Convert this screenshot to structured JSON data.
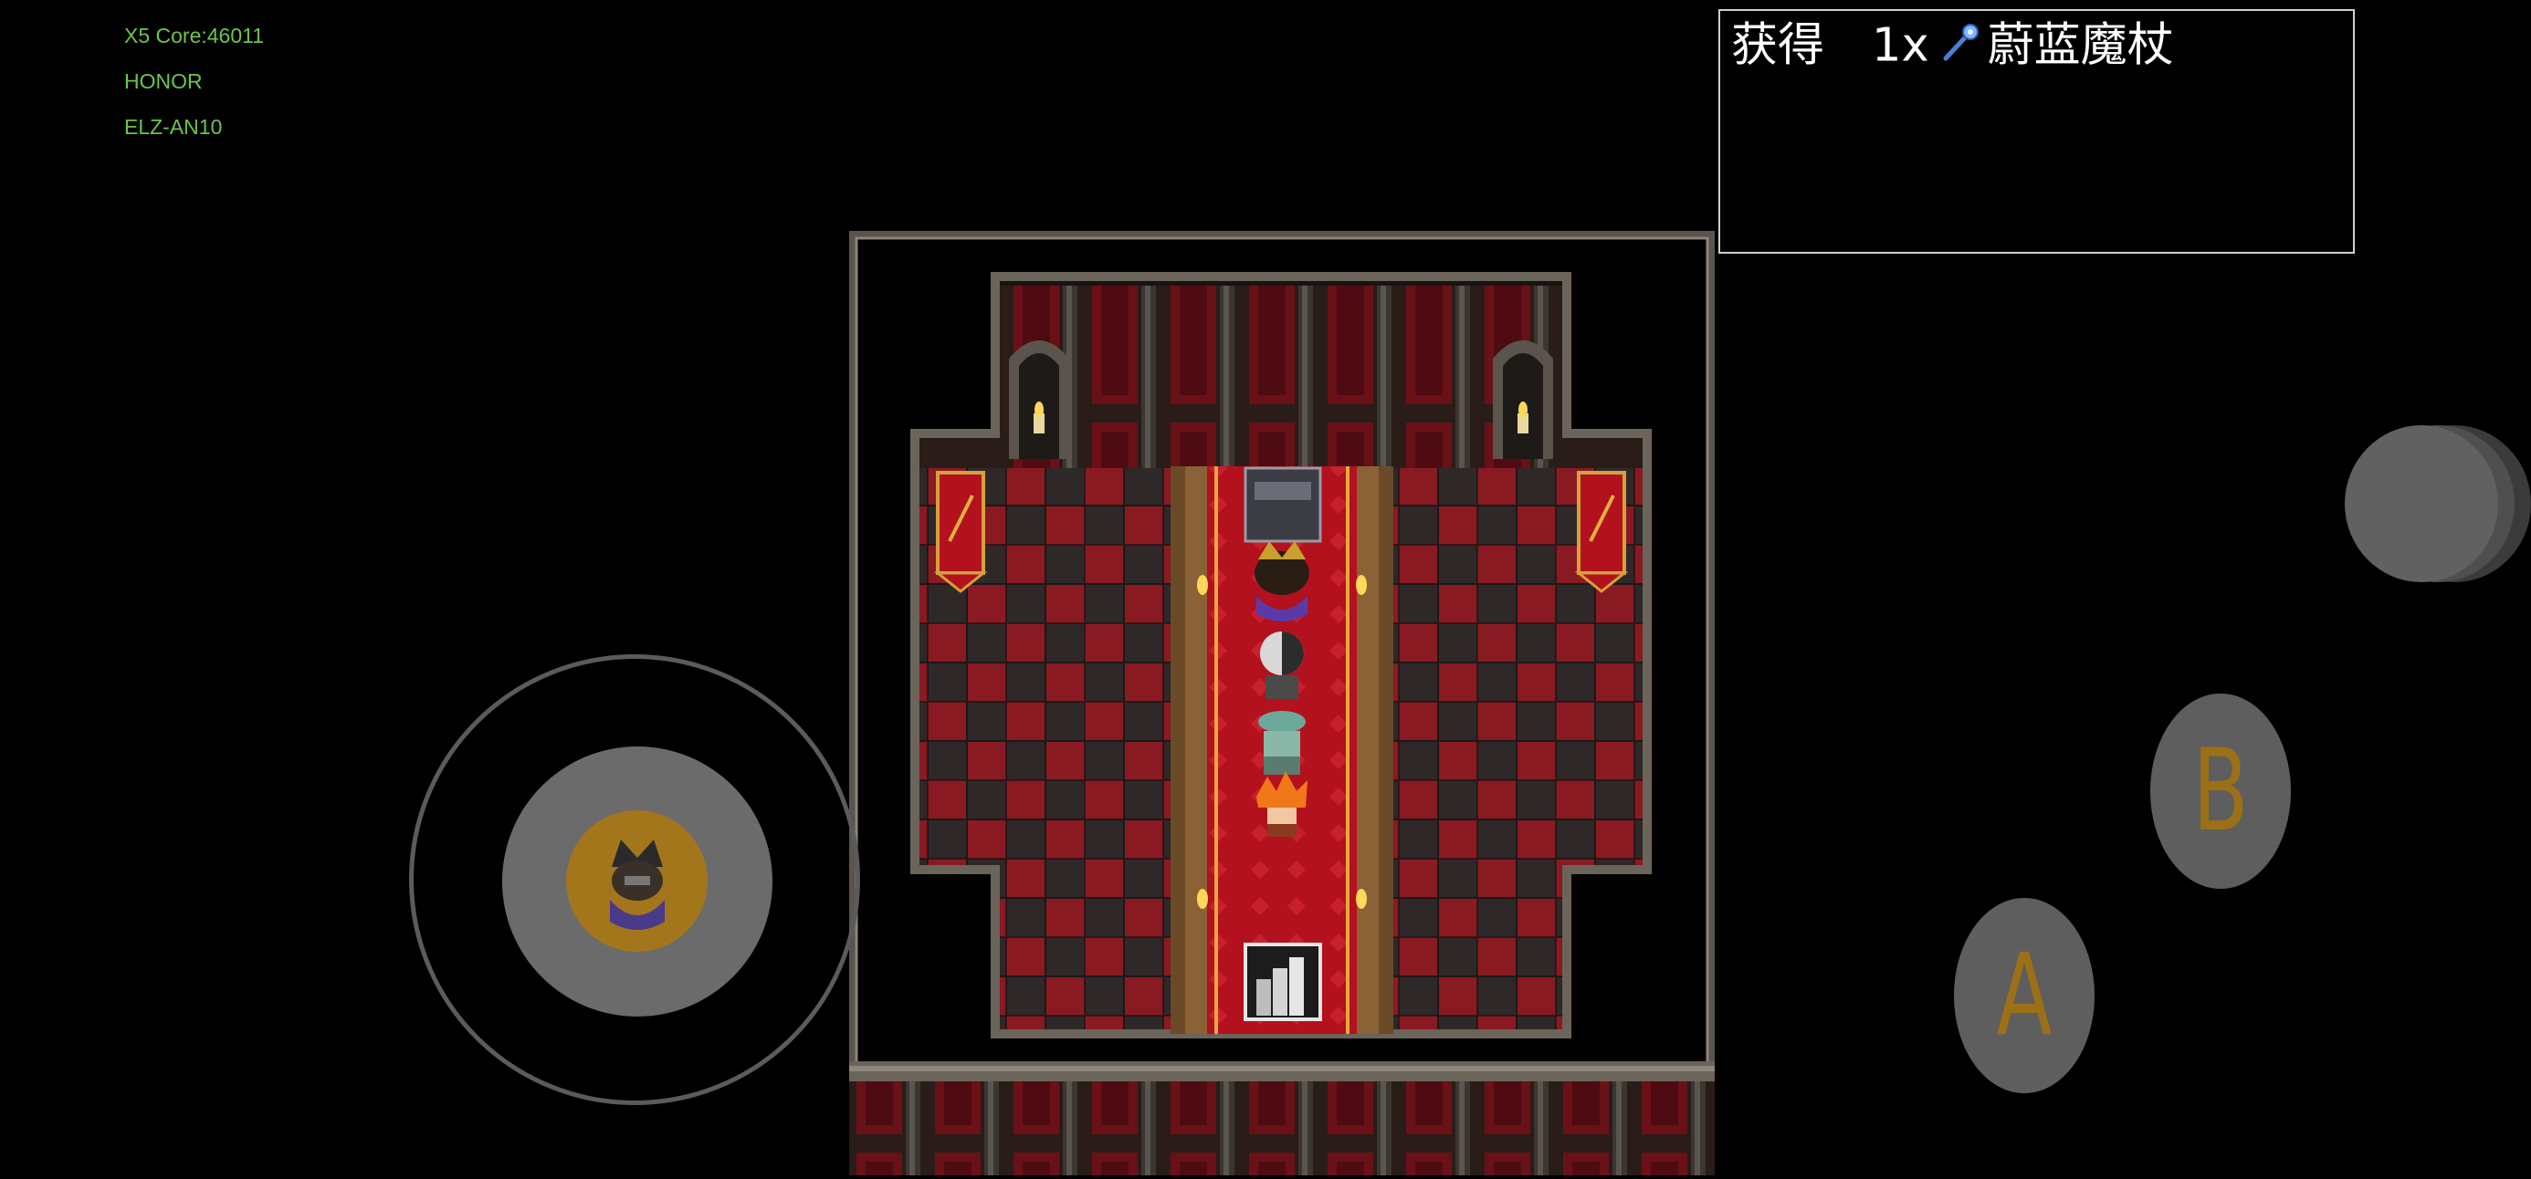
{
  "debug": {
    "core": "X5 Core:46011",
    "brand": "HONOR",
    "model": "ELZ-AN10"
  },
  "message": {
    "verb": "获得",
    "count": "1x",
    "item_icon": "blue-staff-icon",
    "item_name": "蔚蓝魔杖"
  },
  "controls": {
    "button_a": "A",
    "button_b": "B",
    "joystick_avatar": "hero-portrait-icon",
    "menu_button": "menu-button"
  },
  "colors": {
    "debug_text": "#6cc644",
    "button_letter": "#9c7016",
    "carpet": "#b3111d",
    "floor_red": "#8a1a22",
    "floor_dark": "#2e2828",
    "wall_stone": "#6b645a"
  }
}
